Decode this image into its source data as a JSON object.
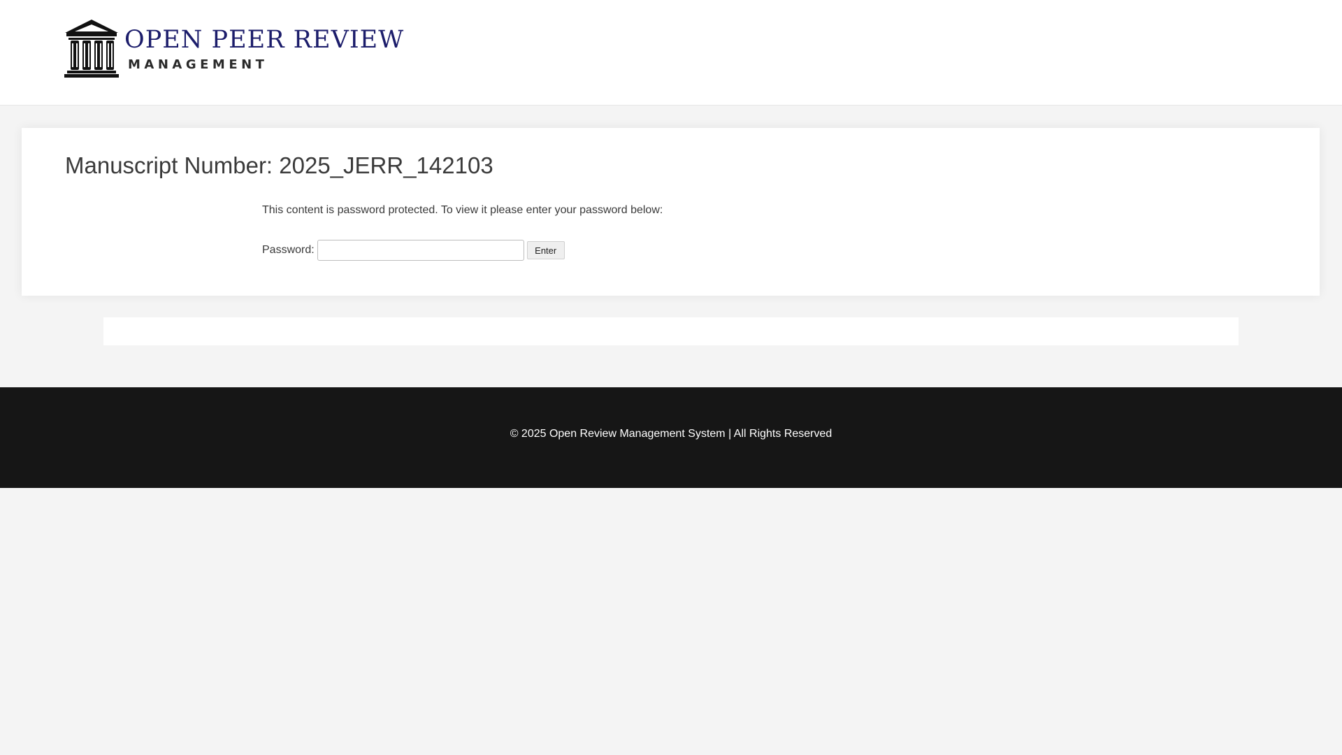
{
  "header": {
    "logo": {
      "icon": "columns-building-icon",
      "line1": "OPEN PEER REVIEW",
      "line2": "MANAGEMENT",
      "color_primary": "#1c1d6b"
    }
  },
  "main": {
    "title": "Manuscript Number: 2025_JERR_142103",
    "message": "This content is password protected. To view it please enter your password below:",
    "password_label": "Password:",
    "password_value": "",
    "enter_label": "Enter"
  },
  "footer": {
    "text": "© 2025 Open Review Management System | All Rights Reserved",
    "background": "#161616"
  }
}
